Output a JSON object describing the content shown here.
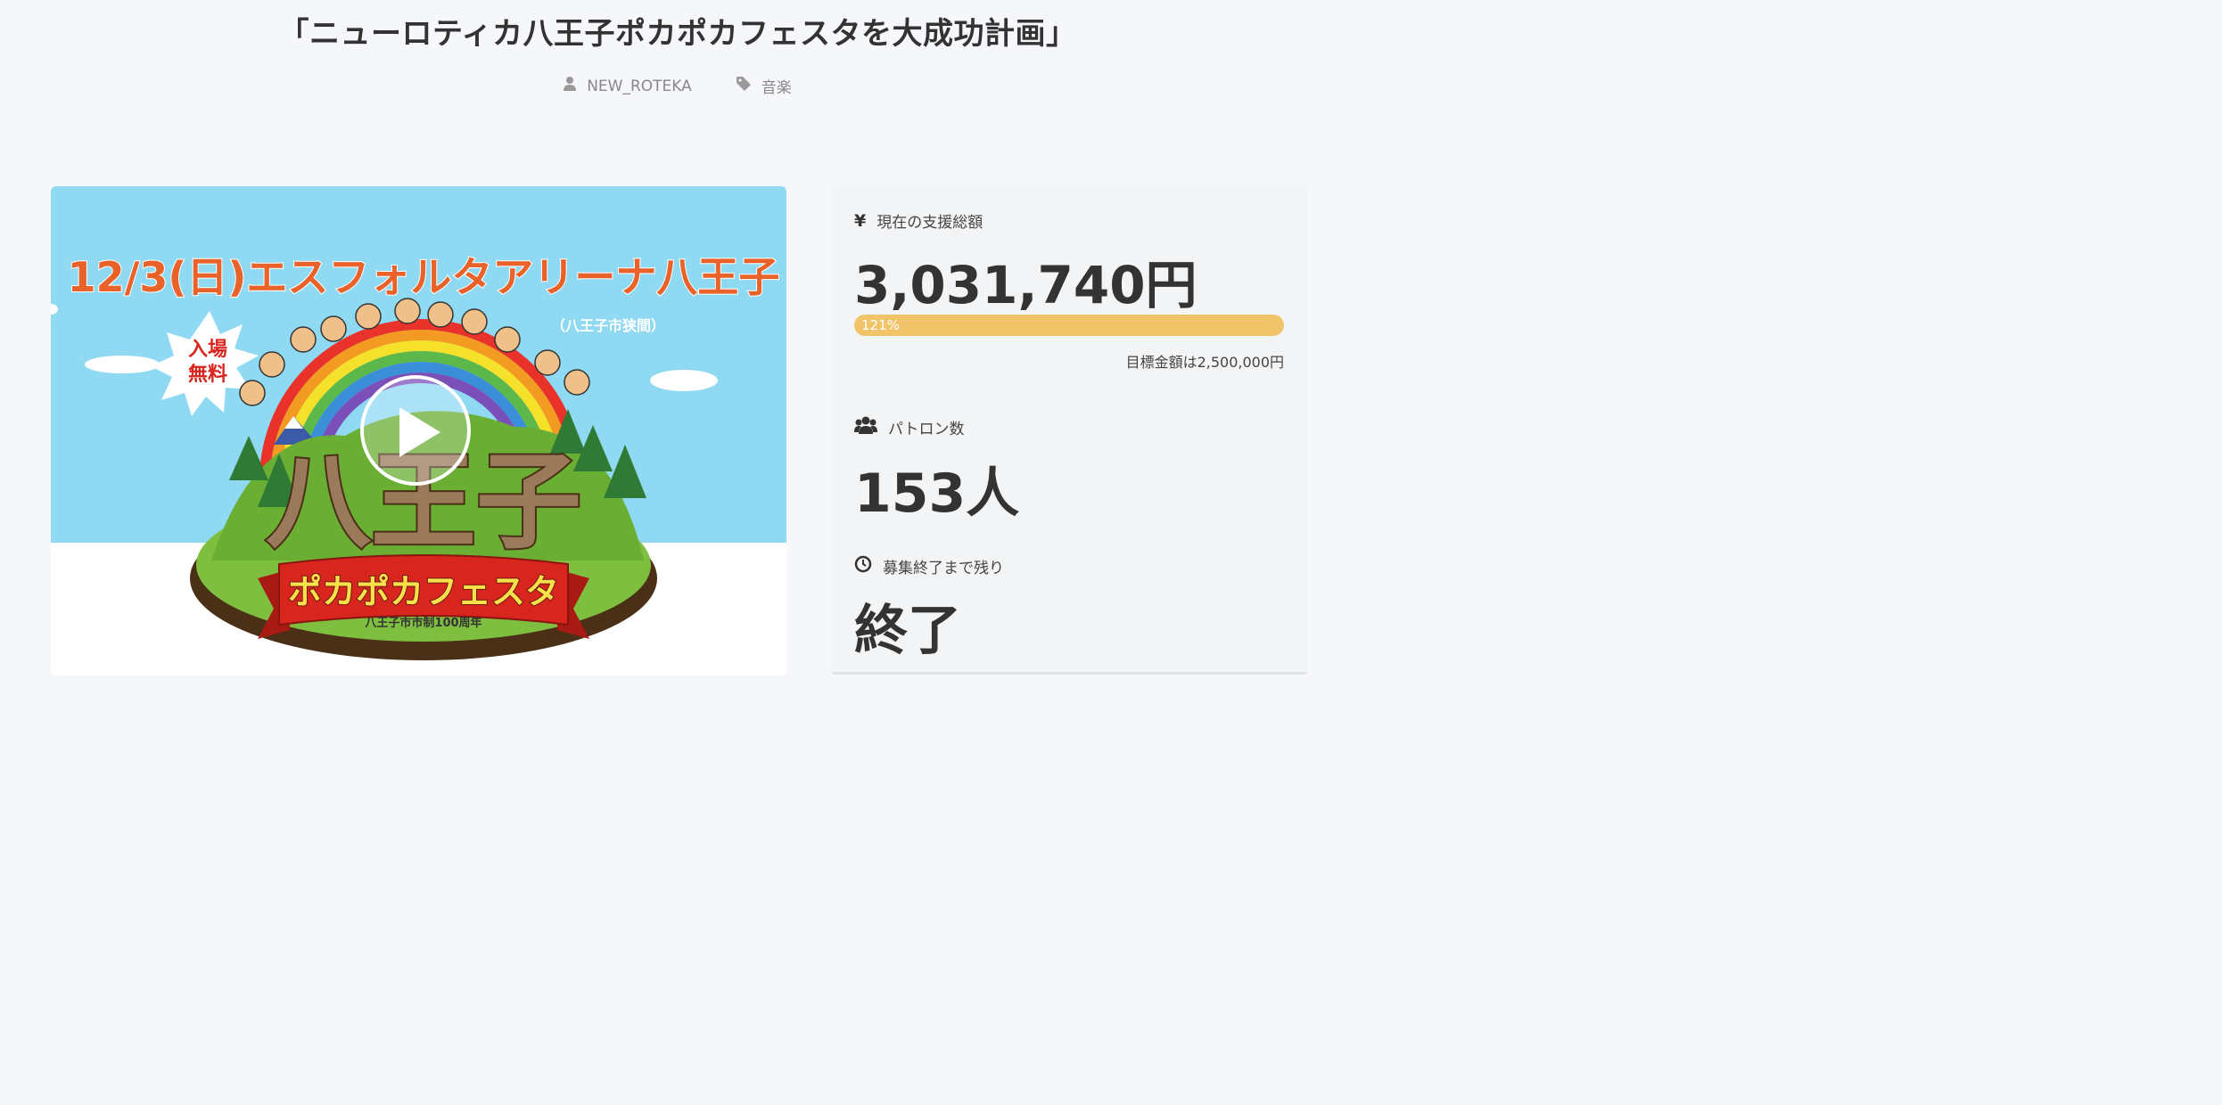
{
  "header": {
    "title": "「ニューロティカ八王子ポカポカフェスタを大成功計画」",
    "author": "NEW_ROTEKA",
    "category": "音楽",
    "author_icon": "user-icon",
    "category_icon": "tag-icon"
  },
  "video": {
    "date_venue": "12/3(日)エスフォルタアリーナ八王子",
    "venue_note": "（八王子市狭間）",
    "badge_line1": "入場",
    "badge_line2": "無料",
    "logo_text": "八王子",
    "banner_text": "ポカポカフェスタ",
    "banner_sub": "八王子市市制100周年",
    "play_icon": "play-icon"
  },
  "stats": {
    "funding_label": "現在の支援総額",
    "funding_icon": "yen-icon",
    "funding_amount": "3,031,740円",
    "progress_text": "121%",
    "progress_value": 1.21,
    "goal_text": "目標金額は2,500,000円",
    "patron_label": "パトロン数",
    "patron_icon": "users-icon",
    "patron_count": "153人",
    "remaining_label": "募集終了まで残り",
    "remaining_icon": "clock-icon",
    "remaining_value": "終了"
  },
  "colors": {
    "progress": "#f2c46a",
    "sky": "#8fd9f2",
    "title_orange": "#e8622a",
    "banner_red": "#d8261e",
    "hill_green": "#7fbf3f"
  }
}
